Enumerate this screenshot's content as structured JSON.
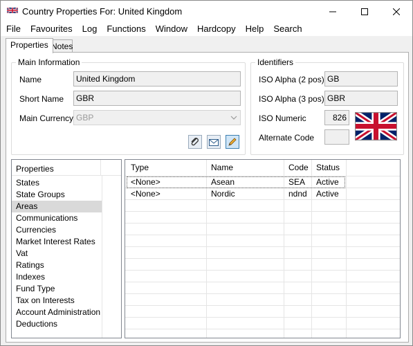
{
  "window": {
    "title": "Country Properties For: United Kingdom",
    "controls": {
      "minimize": "minimize",
      "maximize": "maximize",
      "close": "close"
    }
  },
  "menu": [
    "File",
    "Favourites",
    "Log",
    "Functions",
    "Window",
    "Hardcopy",
    "Help",
    "Search"
  ],
  "tabs": {
    "properties": "Properties",
    "notes": "Notes"
  },
  "main_info": {
    "group_label": "Main Information",
    "name_label": "Name",
    "name_value": "United Kingdom",
    "short_name_label": "Short Name",
    "short_name_value": "GBR",
    "currency_label": "Main Currency",
    "currency_value": "GBP"
  },
  "identifiers": {
    "group_label": "Identifiers",
    "iso2_label": "ISO Alpha (2 pos)",
    "iso2_value": "GB",
    "iso3_label": "ISO Alpha (3 pos)",
    "iso3_value": "GBR",
    "numeric_label": "ISO Numeric",
    "numeric_value": "826",
    "alternate_label": "Alternate Code",
    "alternate_value": ""
  },
  "properties_list": {
    "header": "Properties",
    "items": [
      "States",
      "State Groups",
      "Areas",
      "Communications",
      "Currencies",
      "Market Interest Rates",
      "Vat",
      "Ratings",
      "Indexes",
      "Fund Type",
      "Tax on Interests",
      "Account Administration",
      "Deductions"
    ],
    "selected": "Areas"
  },
  "areas_grid": {
    "columns": [
      "Type",
      "Name",
      "Code",
      "Status"
    ],
    "rows": [
      [
        "<None>",
        "Asean",
        "SEA",
        "Active"
      ],
      [
        "<None>",
        "Nordic",
        "ndnd",
        "Active"
      ]
    ]
  },
  "icons": {
    "attach": "paperclip-icon",
    "mail": "envelope-icon",
    "edit": "pencil-icon"
  },
  "colors": {
    "flag_blue": "#012169",
    "flag_red": "#c8102e",
    "selected_row": "#d9d9d9"
  }
}
